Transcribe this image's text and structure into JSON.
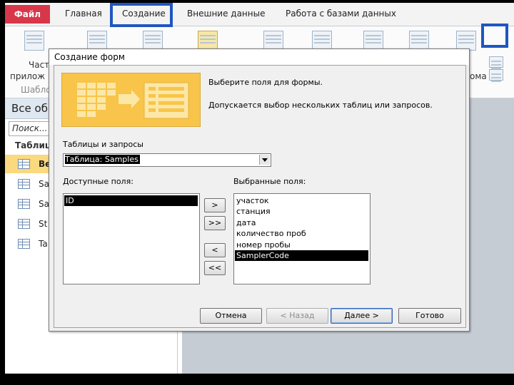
{
  "app": {
    "tabs": [
      "Файл",
      "Главная",
      "Создание",
      "Внешние данные",
      "Работа с базами данных"
    ],
    "ribbon_left_labels": [
      "Част",
      "прилож",
      "Шабло"
    ],
    "ribbon_right_label": "ома"
  },
  "nav": {
    "header": "Все об",
    "search_placeholder": "Поиск...",
    "group": "Таблиц",
    "items": [
      "Be",
      "Sa",
      "Sa",
      "St",
      "Ta"
    ]
  },
  "dialog": {
    "title": "Создание форм",
    "intro1": "Выберите поля для формы.",
    "intro2": "Допускается выбор нескольких таблиц или запросов.",
    "tables_label": "Таблицы и запросы",
    "table_selected": "Таблица: Samples",
    "available_label": "Доступные поля:",
    "available_fields": [
      "ID"
    ],
    "selected_label": "Выбранные поля:",
    "selected_fields": [
      "участок",
      "станция",
      "дата",
      "количество проб",
      "номер пробы",
      "SamplerCode"
    ],
    "move_one": ">",
    "move_all": ">>",
    "remove_one": "<",
    "remove_all": "<<",
    "cancel": "Отмена",
    "back": "< Назад",
    "next": "Далее >",
    "finish": "Готово"
  },
  "colors": {
    "highlight": "#1f56c0",
    "file_tab": "#d8374a",
    "nav_selected": "#fbd97e"
  }
}
